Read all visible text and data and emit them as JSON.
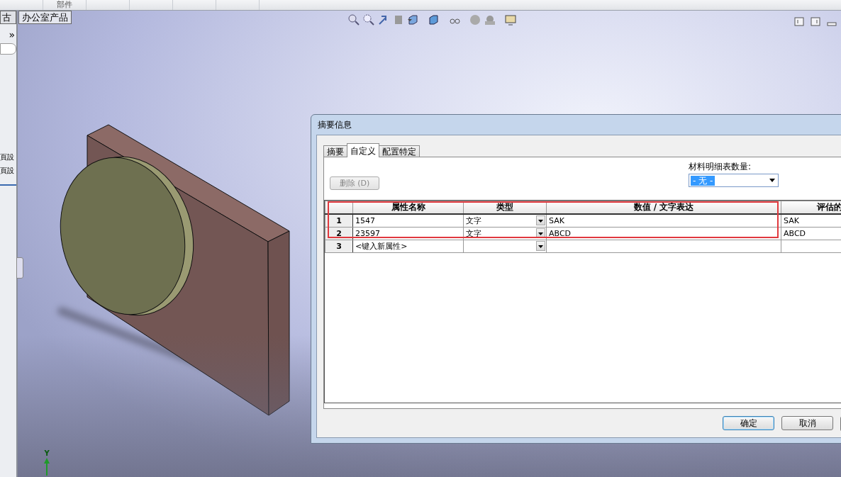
{
  "top_toolbar": {
    "label": "部件"
  },
  "doc_tabs": [
    {
      "label": "古",
      "selected": false
    },
    {
      "label": "办公室产品",
      "selected": true
    }
  ],
  "left_panel": {
    "expand": "»",
    "items": [
      "頁設",
      "頁設"
    ]
  },
  "axis": {
    "label": "Y"
  },
  "dialog": {
    "title": "摘要信息",
    "tabs": [
      {
        "label": "摘要",
        "selected": false
      },
      {
        "label": "自定义",
        "selected": true
      },
      {
        "label": "配置特定",
        "selected": false
      }
    ],
    "delete_button": {
      "label": "删除 (D)",
      "disabled": true
    },
    "bom_quantity": {
      "label": "材料明细表数量:",
      "value": "- 无 -"
    },
    "table": {
      "columns": [
        "属性名称",
        "类型",
        "数值 / 文字表达",
        "评估的"
      ],
      "rows": [
        {
          "index": "1",
          "name": "1547",
          "type": "文字",
          "value": "SAK",
          "evaluated": "SAK"
        },
        {
          "index": "2",
          "name": "23597",
          "type": "文字",
          "value": "ABCD",
          "evaluated": "ABCD"
        },
        {
          "index": "3",
          "name": "<键入新属性>"
        }
      ]
    },
    "buttons": [
      {
        "label": "确定",
        "default": true
      },
      {
        "label": "取消",
        "default": false
      }
    ]
  }
}
